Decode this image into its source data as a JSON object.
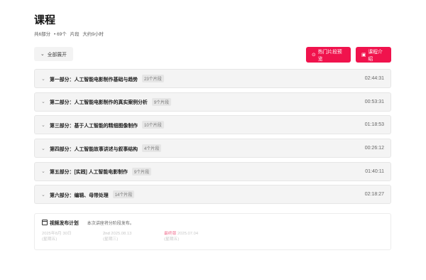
{
  "header": {
    "title": "课程",
    "meta": [
      "共6部分",
      "• 69个",
      "片段",
      "大约9小时"
    ]
  },
  "toolbar": {
    "expand_label": "全部展开",
    "preview_label": "热门片段预览",
    "intro_label": "课程介绍"
  },
  "sections": [
    {
      "name": "第一部分：人工智能电影制作基础与趋势",
      "count": "23个片段",
      "duration": "02:44:31"
    },
    {
      "name": "第二部分：人工智能电影制作的真实案例分析",
      "count": "9个片段",
      "duration": "00:53:31"
    },
    {
      "name": "第三部分：基于人工智能的精细图像制作",
      "count": "10个片段",
      "duration": "01:18:53"
    },
    {
      "name": "第四部分：人工智能故事讲述与叙事结构",
      "count": "4个片段",
      "duration": "00:26:12"
    },
    {
      "name": "第五部分：[实践] 人工智能电影制作",
      "count": "9个片段",
      "duration": "01:40:11"
    },
    {
      "name": "第六部分：编辑、母带处理",
      "count": "14个片段",
      "duration": "02:18:27"
    }
  ],
  "plan": {
    "title": "视频发布计划",
    "desc": "本次讲座将分阶段发布。",
    "cols": [
      {
        "tag": "",
        "line1": "2025年8月 30日",
        "line2": "(星期五)"
      },
      {
        "tag": "2nd",
        "line1": "2025.08.13",
        "line2": "(星期三)"
      },
      {
        "tag": "最终版",
        "line1": "2025.07.04",
        "line2": "(星期五)"
      }
    ]
  }
}
